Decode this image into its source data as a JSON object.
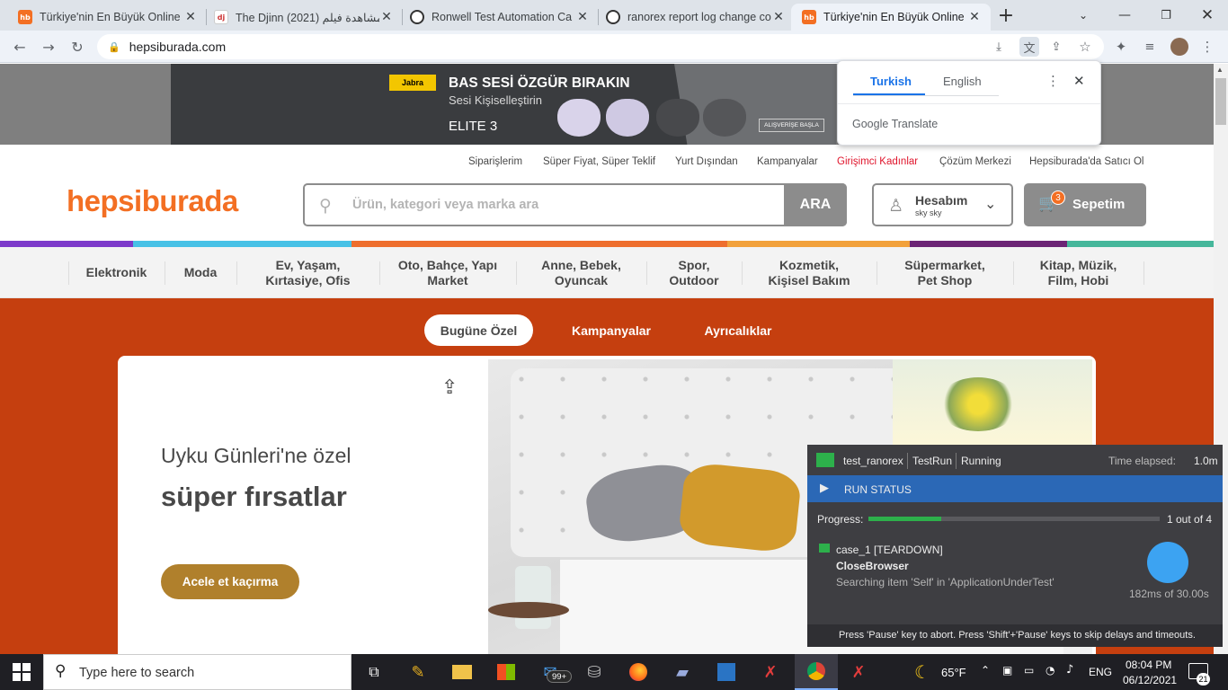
{
  "browser": {
    "tabs": [
      {
        "title": "Türkiye'nin En Büyük Online",
        "favicon": "hb"
      },
      {
        "title": "The Djinn (2021) مشاهدة فيلم",
        "favicon": "dj"
      },
      {
        "title": "Ronwell Test Automation Ca",
        "favicon": "globe"
      },
      {
        "title": "ranorex report log change co",
        "favicon": "globe"
      },
      {
        "title": "Türkiye'nin En Büyük Online",
        "favicon": "hb"
      }
    ],
    "url": "hepsiburada.com",
    "colors": {
      "tabstrip": "#dee3e9",
      "active_tab": "#eef2f8"
    }
  },
  "translate_popup": {
    "tabs": [
      "Turkish",
      "English"
    ],
    "active": "Turkish",
    "brand": "Google",
    "brand_suffix": "Translate"
  },
  "banner": {
    "brand": "Jabra",
    "headline": "BAS SESİ ÖZGÜR BIRAKIN",
    "subline": "Sesi Kişiselleştirin",
    "product": "ELITE 3",
    "cta": "ALIŞVERİŞE BAŞLA"
  },
  "site": {
    "logo": "hepsiburada",
    "brand_color": "#f36f23",
    "top_links": [
      "Siparişlerim",
      "Süper Fiyat, Süper Teklif",
      "Yurt Dışından",
      "Kampanyalar",
      "Girişimci Kadınlar",
      "Çözüm Merkezi",
      "Hepsiburada'da Satıcı Ol"
    ],
    "search_placeholder": "Ürün, kategori veya marka ara",
    "search_button": "ARA",
    "account_title": "Hesabım",
    "account_user": "sky sky",
    "cart_label": "Sepetim",
    "cart_count": "3",
    "categories": [
      "Elektronik",
      "Moda",
      "Ev, Yaşam,\nKırtasiye, Ofis",
      "Oto, Bahçe, Yapı\nMarket",
      "Anne, Bebek,\nOyuncak",
      "Spor,\nOutdoor",
      "Kozmetik,\nKişisel Bakım",
      "Süpermarket,\nPet Shop",
      "Kitap, Müzik,\nFilm, Hobi"
    ]
  },
  "hero": {
    "tabs": [
      "Bugüne Özel",
      "Kampanyalar",
      "Ayrıcalıklar"
    ],
    "line1": "Uyku Günleri'ne özel",
    "line2": "süper fırsatlar",
    "cta": "Acele et kaçırma",
    "bg_color": "#c53f0f"
  },
  "ranorex": {
    "test": "test_ranorex",
    "run": "TestRun",
    "state": "Running",
    "elapsed_label": "Time elapsed:",
    "elapsed": "1.0m",
    "status_title": "RUN STATUS",
    "progress_label": "Progress:",
    "progress_fraction": 0.25,
    "progress_text": "1 out of 4",
    "case": "case_1 [TEARDOWN]",
    "action": "CloseBrowser",
    "detail": "Searching item 'Self' in 'ApplicationUnderTest'",
    "timer": "182ms of 30.00s",
    "footer": "Press 'Pause' key to abort. Press 'Shift'+'Pause' keys to skip delays and timeouts."
  },
  "taskbar": {
    "search_placeholder": "Type here to search",
    "mail_badge": "99+",
    "temperature": "65°F",
    "language": "ENG",
    "time": "08:04 PM",
    "date": "06/12/2021",
    "notifications": "21"
  }
}
